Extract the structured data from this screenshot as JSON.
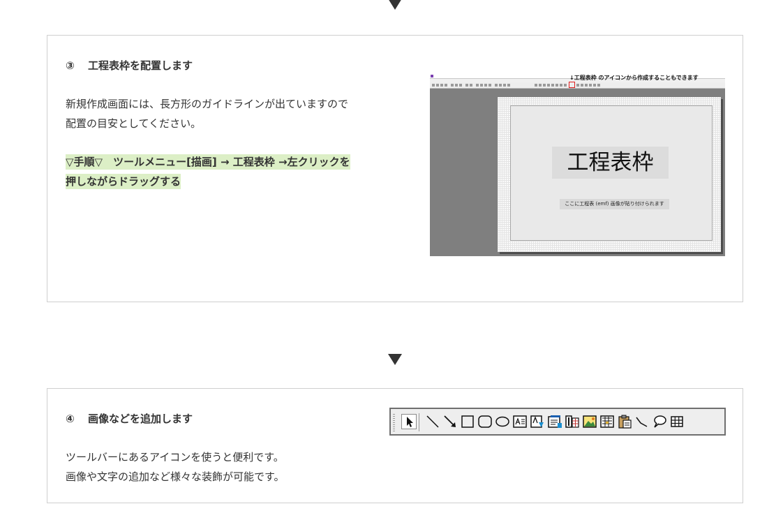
{
  "step3": {
    "number": "③",
    "title": "工程表枠を配置します",
    "description": [
      "新規作成画面には、長方形のガイドラインが出ていますので",
      "配置の目安としてください。"
    ],
    "procedure": [
      "▽手順▽　ツールメニュー[描画] → 工程表枠 →左クリックを",
      "押しながらドラッグする"
    ],
    "screenshot": {
      "note": "↓工程表枠 のアイコンから作成することもできます",
      "frame_label": "工程表枠",
      "emf_label": "ここに工程表 (emf) 画像が貼り付けられます"
    }
  },
  "step4": {
    "number": "④",
    "title": "画像などを追加します",
    "description": [
      "ツールバーにあるアイコンを使うと便利です。",
      "画像や文字の追加など様々な装飾が可能です。"
    ],
    "toolbar_icons": [
      "pointer-icon",
      "line-icon",
      "arrow-line-icon",
      "rectangle-icon",
      "rounded-rectangle-icon",
      "ellipse-icon",
      "text-box-icon",
      "text-icon",
      "document-icon",
      "table-number-icon",
      "image-icon",
      "text-frame-icon",
      "paste-icon",
      "connector-icon",
      "callout-icon",
      "grid-icon"
    ]
  },
  "colors": {
    "highlight": "#dcefc6",
    "text": "#333333",
    "border": "#cfcfcf"
  }
}
